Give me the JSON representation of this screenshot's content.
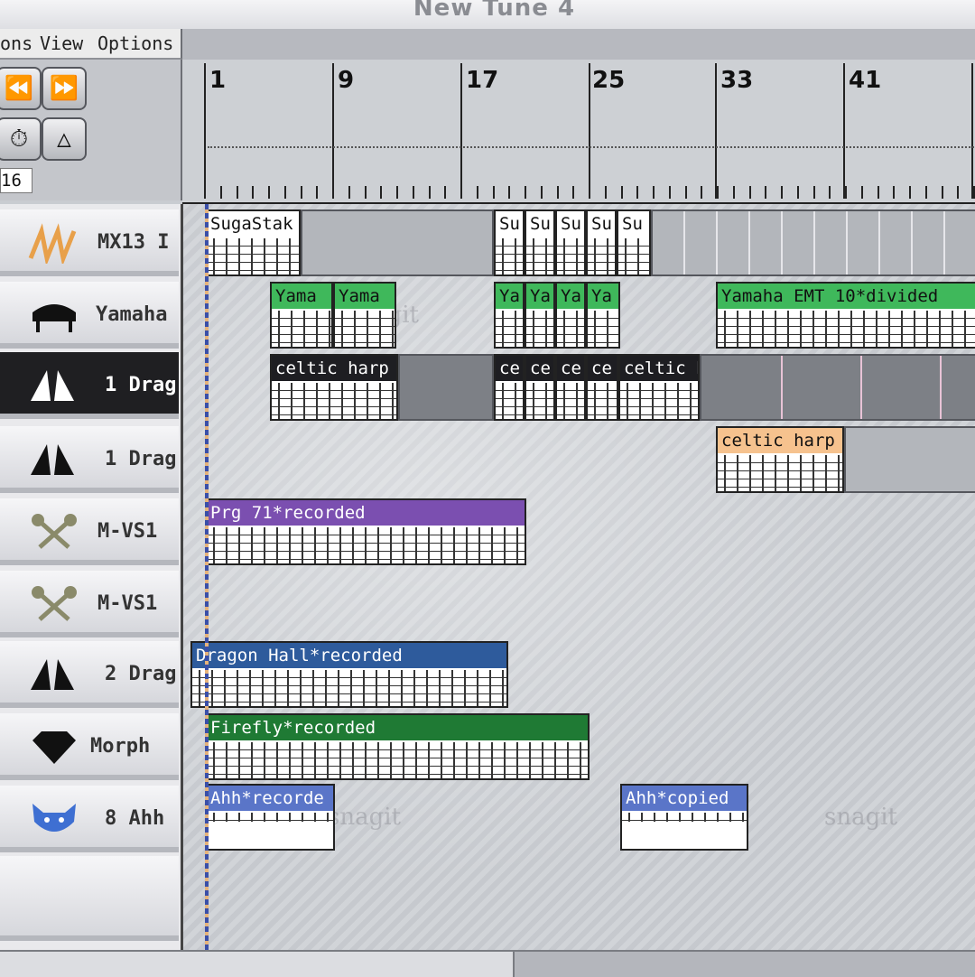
{
  "window": {
    "title": "New Tune 4"
  },
  "menu": {
    "items": [
      "ons",
      "View",
      "Options"
    ]
  },
  "transport": {
    "counter": "16"
  },
  "ruler": {
    "bars": [
      "1",
      "9",
      "17",
      "25",
      "33",
      "41"
    ]
  },
  "tracks": [
    {
      "label": "MX13 I",
      "icon": "synth-wave-icon"
    },
    {
      "label": "Yamaha",
      "icon": "piano-icon"
    },
    {
      "label": "1 Drag",
      "icon": "dragon-wing-icon",
      "selected": true
    },
    {
      "label": "1 Drag",
      "icon": "dragon-wing-icon"
    },
    {
      "label": "M-VS1",
      "icon": "crossed-mallets-icon"
    },
    {
      "label": "M-VS1",
      "icon": "crossed-mallets-icon"
    },
    {
      "label": "2 Drag",
      "icon": "dragon-wing-icon"
    },
    {
      "label": "Morph",
      "icon": "diamond-icon"
    },
    {
      "label": "8 Ahh",
      "icon": "cat-face-icon"
    }
  ],
  "regions": {
    "r1": "SugaStak",
    "r2": "Su",
    "r3": "Yama",
    "r4": "Ya",
    "r5": "Yamaha EMT 10*divided",
    "r6": "celtic harp e",
    "r7": "ce",
    "r8": "celtic h",
    "r9": "celtic harp e",
    "r10": "Prg 71*recorded",
    "r11": "Dragon Hall*recorded",
    "r12": "Firefly*recorded",
    "r13": "Ahh*recorde",
    "r14": "Ahh*copied"
  },
  "colors": {
    "green": "#3fb85b",
    "purple": "#7b4fb0",
    "blue": "#2e5b9c",
    "darkgreen": "#1f7a34",
    "periwinkle": "#5a75c8",
    "peach": "#f6c28e",
    "dark": "#1e1e22"
  },
  "watermark": "snagit"
}
